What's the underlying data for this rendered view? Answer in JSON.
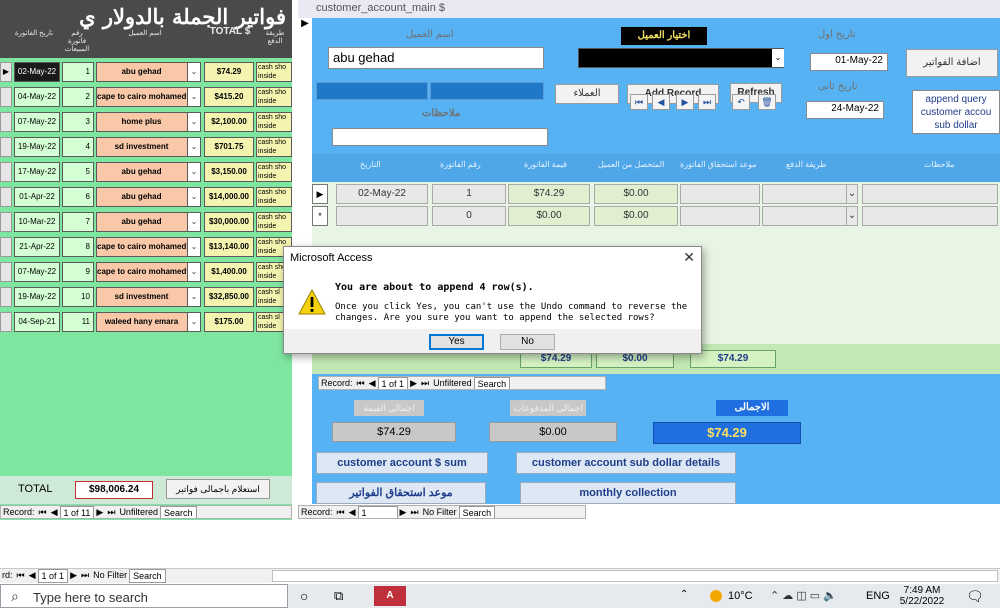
{
  "left_form": {
    "title": "فواتير الجملة بالدولار",
    "title_prefix": "ي",
    "headers": {
      "pay_method": "طريقة الدفع",
      "total": "TOTAL $",
      "customer": "اسم العميل",
      "invoice_no": "رقم فاتورة المبيعات",
      "invoice_date": "تاريخ الفاتورة"
    },
    "rows": [
      {
        "date": "02-May-22",
        "num": "1",
        "customer": "abu gehad",
        "amount": "$74.29",
        "pay": "cash sho inside",
        "selected": true
      },
      {
        "date": "04-May-22",
        "num": "2",
        "customer": "cape to cairo mohamed",
        "amount": "$415.20",
        "pay": "cash sho inside",
        "selected": false
      },
      {
        "date": "07-May-22",
        "num": "3",
        "customer": "home plus",
        "amount": "$2,100.00",
        "pay": "cash sho inside",
        "selected": false
      },
      {
        "date": "19-May-22",
        "num": "4",
        "customer": "sd investment",
        "amount": "$701.75",
        "pay": "cash sho inside",
        "selected": false
      },
      {
        "date": "17-May-22",
        "num": "5",
        "customer": "abu gehad",
        "amount": "$3,150.00",
        "pay": "cash sho inside",
        "selected": false
      },
      {
        "date": "01-Apr-22",
        "num": "6",
        "customer": "abu gehad",
        "amount": "$14,000.00",
        "pay": "cash sho inside",
        "selected": false
      },
      {
        "date": "10-Mar-22",
        "num": "7",
        "customer": "abu gehad",
        "amount": "$30,000.00",
        "pay": "cash sho inside",
        "selected": false
      },
      {
        "date": "21-Apr-22",
        "num": "8",
        "customer": "cape to cairo mohamed",
        "amount": "$13,140.00",
        "pay": "cash sho inside",
        "selected": false
      },
      {
        "date": "07-May-22",
        "num": "9",
        "customer": "cape to cairo mohamed",
        "amount": "$1,400.00",
        "pay": "cash sho inside",
        "selected": false
      },
      {
        "date": "19-May-22",
        "num": "10",
        "customer": "sd investment",
        "amount": "$32,850.00",
        "pay": "cash sl inside",
        "selected": false
      },
      {
        "date": "04-Sep-21",
        "num": "11",
        "customer": "waleed hany emara",
        "amount": "$175.00",
        "pay": "cash sl inside",
        "selected": false
      }
    ],
    "total_label": "TOTAL",
    "total_value": "$98,006.24",
    "footer_button": "استعلام باجمالى فواتير",
    "nav": {
      "record_label": "Record:",
      "position": "1 of 11",
      "filter": "Unfiltered",
      "search": "Search"
    }
  },
  "right_form": {
    "tab_title": "customer_account_main $",
    "customer_name_label": "اسم العميل",
    "customer_name_value": "abu gehad",
    "choose_customer_label": "اختيار العميل",
    "date1_label": "تاريخ اول",
    "date1_value": "01-May-22",
    "date2_label": "تاريخ ثانى",
    "date2_value": "24-May-22",
    "add_invoices_button": "اضافة الفواتير",
    "append_query_text": "append query customer accou sub dollar",
    "customers_button": "العملاء",
    "add_record_button": "Add Record",
    "refresh_button": "Refresh",
    "notes_label": "ملاحظات",
    "sub_headers": {
      "date": "التاريخ",
      "invoice_no": "رقم الفاتورة",
      "invoice_value": "قيمة الفاتورة",
      "collected": "المتحصل من العميل",
      "due_date": "موعد استحقاق الفاتورة",
      "pay_method": "طريقة الدفع",
      "notes": "ملاحظات"
    },
    "sub_rows": [
      {
        "marker": "▶",
        "date": "02-May-22",
        "num": "1",
        "value": "$74.29",
        "collected": "$0.00"
      },
      {
        "marker": "*",
        "date": "",
        "num": "0",
        "value": "$0.00",
        "collected": "$0.00"
      }
    ],
    "sub_totals": [
      "$74.29",
      "$0.00",
      "$74.29"
    ],
    "sub_nav": {
      "record_label": "Record:",
      "position": "1 of 1",
      "filter": "Unfiltered",
      "search": "Search"
    },
    "total_value_label": "اجمالى القيمة",
    "total_value": "$74.29",
    "total_paid_label": "اجمالى المدفوعات",
    "total_paid": "$0.00",
    "grand_total_label": "الاجمالى",
    "grand_total": "$74.29",
    "btn_sum": "customer account $ sum",
    "btn_sub_details": "customer account sub dollar details",
    "btn_due": "موعد استحقاق الفواتير",
    "btn_monthly": "monthly collection",
    "nav": {
      "record_label": "Record:",
      "position": "1",
      "filter": "No Filter",
      "search": "Search"
    }
  },
  "dialog": {
    "title": "Microsoft Access",
    "heading": "You are about to append 4 row(s).",
    "message": "Once you click Yes, you can't use the Undo command to reverse the changes. Are you sure you want to append the selected rows?",
    "yes": "Yes",
    "no": "No",
    "icon": "warning-icon"
  },
  "main_nav": {
    "record_label": "rd:",
    "position": "1 of 1",
    "filter": "No Filter",
    "search": "Search"
  },
  "taskbar": {
    "search_placeholder": "Type here to search",
    "weather": "10°C",
    "language": "ENG",
    "time": "7:49 AM",
    "date": "5/22/2022"
  },
  "colors": {
    "left_bg": "#7fe6a0",
    "right_bg": "#56b2f2",
    "header_dark": "#4a4a4a"
  }
}
